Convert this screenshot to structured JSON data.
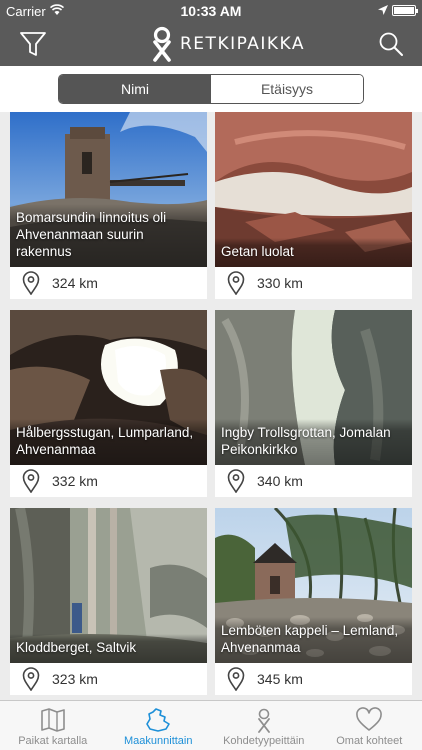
{
  "status_bar": {
    "carrier": "Carrier",
    "time": "10:33 AM"
  },
  "nav": {
    "logo_text": "RETKIPAIKKA"
  },
  "segment": {
    "options": [
      "Nimi",
      "Etäisyys"
    ],
    "selected": "Nimi"
  },
  "places": [
    {
      "name": "Bomarsundin linnoitus oli Ahvenanmaan suurin rakennus",
      "distance": "324 km"
    },
    {
      "name": "Getan luolat",
      "distance": "330 km"
    },
    {
      "name": "Hålbergsstugan, Lumparland, Ahvenanmaa",
      "distance": "332 km"
    },
    {
      "name": "Ingby Trollsgrottan, Jomalan Peikonkirkko",
      "distance": "340 km"
    },
    {
      "name": "Kloddberget, Saltvik",
      "distance": "323 km"
    },
    {
      "name": "Lemböten kappeli – Lemland, Ahvenanmaa",
      "distance": "345 km"
    }
  ],
  "tabs": [
    {
      "label": "Paikat kartalla",
      "icon": "map-icon",
      "active": false
    },
    {
      "label": "Maakunnittain",
      "icon": "region-icon",
      "active": true
    },
    {
      "label": "Kohdetyypeittäin",
      "icon": "category-icon",
      "active": false
    },
    {
      "label": "Omat kohteet",
      "icon": "heart-icon",
      "active": false
    }
  ],
  "colors": {
    "bar": "#5a5a5a",
    "accent": "#1e90d8",
    "background": "#ececec"
  }
}
